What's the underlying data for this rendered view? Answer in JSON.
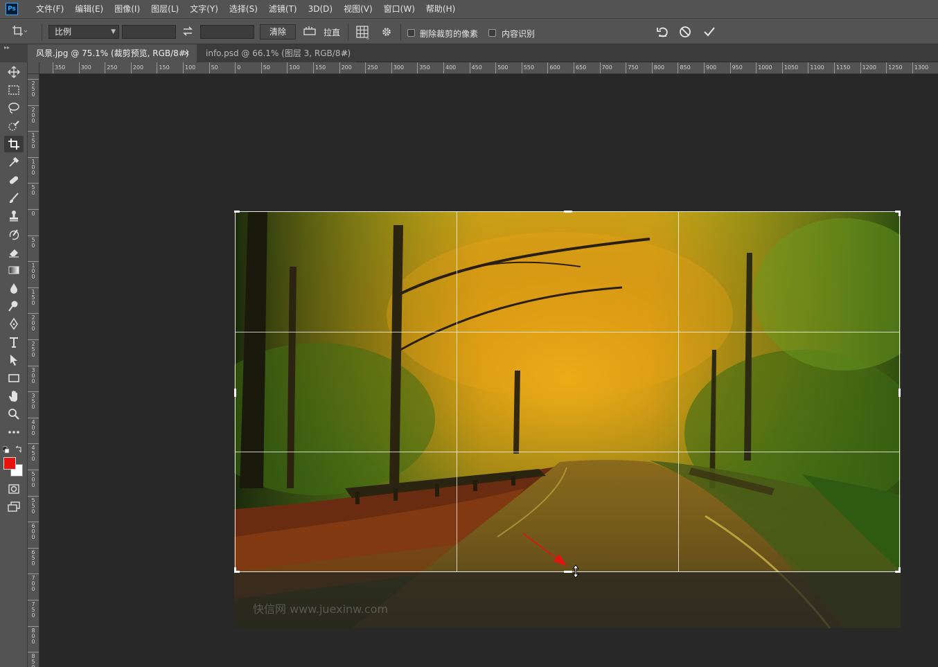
{
  "app": {
    "logo": "Ps"
  },
  "menu": [
    "文件(F)",
    "编辑(E)",
    "图像(I)",
    "图层(L)",
    "文字(Y)",
    "选择(S)",
    "滤镜(T)",
    "3D(D)",
    "视图(V)",
    "窗口(W)",
    "帮助(H)"
  ],
  "options": {
    "ratio_value": "比例",
    "clear_label": "清除",
    "straighten_label": "拉直",
    "delete_cropped_label": "删除裁剪的像素",
    "content_aware_label": "内容识别"
  },
  "tabs": [
    {
      "label": "风景.jpg @ 75.1% (裁剪预览, RGB/8#)",
      "close": "×"
    },
    {
      "label": "info.psd @ 66.1% (图层 3, RGB/8#)",
      "close": "×"
    }
  ],
  "ruler": {
    "h_labels": [
      "350",
      "300",
      "250",
      "200",
      "150",
      "100",
      "50",
      "0",
      "50",
      "100",
      "150",
      "200",
      "250",
      "300",
      "350",
      "400",
      "450",
      "500",
      "550",
      "600",
      "650",
      "700",
      "750",
      "800",
      "850",
      "900",
      "950",
      "1000",
      "1050",
      "1100",
      "1150",
      "1200",
      "1250",
      "1300"
    ],
    "v_labels": [
      "250",
      "200",
      "150",
      "100",
      "50",
      "0",
      "50",
      "100",
      "150",
      "200",
      "250",
      "300",
      "350",
      "400",
      "450",
      "500",
      "550",
      "600",
      "650",
      "700",
      "750",
      "800",
      "850"
    ]
  },
  "canvas": {
    "watermark": "快信网 www.juexinw.com"
  },
  "colors": {
    "foreground": "#e8120c",
    "background": "#ffffff",
    "accent": "#31a8ff"
  }
}
